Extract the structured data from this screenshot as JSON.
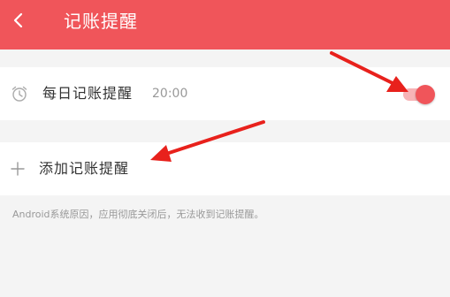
{
  "header": {
    "title": "记账提醒",
    "back_icon": "chevron-left-icon",
    "background_color": "#f0555a"
  },
  "reminder": {
    "icon": "alarm-clock-icon",
    "label": "每日记账提醒",
    "time": "20:00",
    "enabled": true,
    "toggle_color": "#f0555a"
  },
  "add_reminder": {
    "icon": "plus-icon",
    "label": "添加记账提醒"
  },
  "note": "Android系统原因，应用彻底关闭后，无法收到记账提醒。",
  "annotation_color": "#e8211c"
}
